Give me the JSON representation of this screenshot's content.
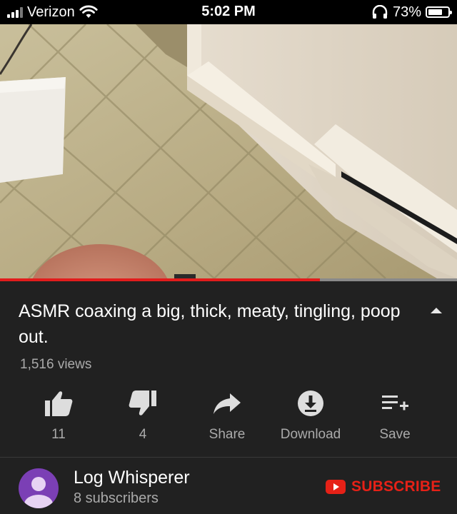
{
  "status_bar": {
    "carrier": "Verizon",
    "time": "5:02 PM",
    "battery_percent": "73%",
    "battery_level": 0.73,
    "icons": [
      "signal-icon",
      "wifi-icon",
      "headphones-icon",
      "battery-icon"
    ]
  },
  "video": {
    "progress": 0.7,
    "thumbnail_description_icon": "video-frame"
  },
  "title": "ASMR coaxing a big, thick, meaty, tingling, poop out.",
  "views": "1,516 views",
  "actions": {
    "like_count": "11",
    "dislike_count": "4",
    "share_label": "Share",
    "download_label": "Download",
    "save_label": "Save"
  },
  "channel": {
    "name": "Log Whisperer",
    "subscribers": "8 subscribers",
    "subscribe_label": "SUBSCRIBE"
  },
  "colors": {
    "background": "#212121",
    "accent_red": "#e62117",
    "secondary_text": "#aaaaaa",
    "avatar": "#7b3fb5"
  }
}
